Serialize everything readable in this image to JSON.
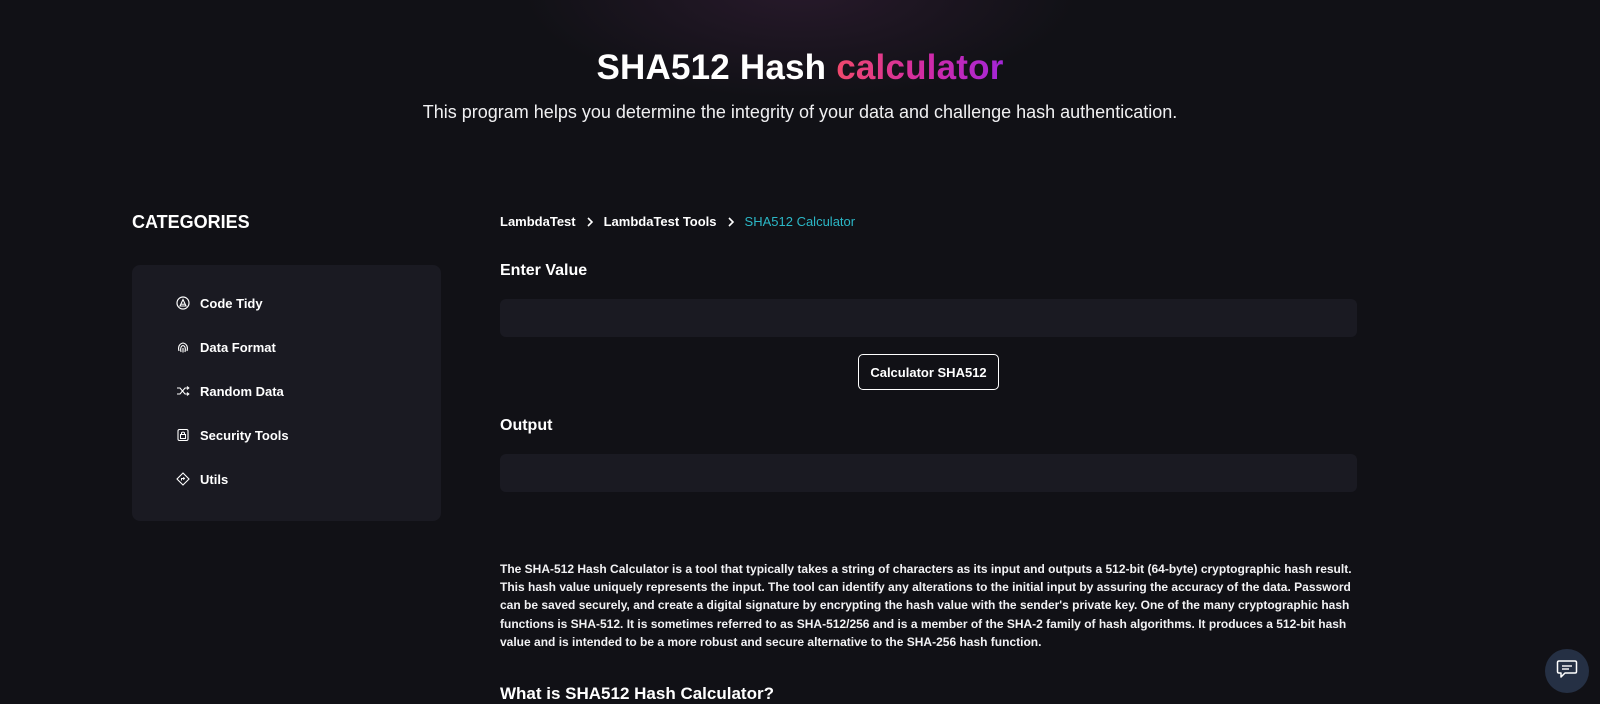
{
  "hero": {
    "title_main": "SHA512 Hash ",
    "title_accent": "calculator",
    "subtitle": "This program helps you determine the integrity of your data and challenge hash authentication."
  },
  "sidebar": {
    "title": "CATEGORIES",
    "items": [
      {
        "label": "Code Tidy",
        "icon": "code-tidy-icon"
      },
      {
        "label": "Data Format",
        "icon": "fingerprint-icon"
      },
      {
        "label": "Random Data",
        "icon": "shuffle-icon"
      },
      {
        "label": "Security Tools",
        "icon": "lock-icon"
      },
      {
        "label": "Utils",
        "icon": "diamond-icon"
      }
    ]
  },
  "breadcrumb": {
    "items": [
      "LambdaTest",
      "LambdaTest Tools"
    ],
    "current": "SHA512 Calculator"
  },
  "form": {
    "input_label": "Enter Value",
    "input_value": "",
    "button_label": "Calculator SHA512",
    "output_label": "Output",
    "output_value": ""
  },
  "content": {
    "description": "The SHA-512 Hash Calculator is a tool that typically takes a string of characters as its input and outputs a 512-bit (64-byte) cryptographic hash result. This hash value uniquely represents the input. The tool can identify any alterations to the initial input by assuring the accuracy of the data. Password can be saved securely, and create a digital signature by encrypting the hash value with the sender's private key. One of the many cryptographic hash functions is SHA-512. It is sometimes referred to as SHA-512/256 and is a member of the SHA-2 family of hash algorithms. It produces a 512-bit hash value and is intended to be a more robust and secure alternative to the SHA-256 hash function.",
    "section_heading": "What is SHA512 Hash Calculator?"
  },
  "chat": {
    "icon": "chat-icon"
  },
  "colors": {
    "background": "#111116",
    "panel": "#1a1a22",
    "accent_start": "#f0496c",
    "accent_end": "#a326d8",
    "breadcrumb_current": "#2bb7c6",
    "chat_button": "#253044"
  }
}
